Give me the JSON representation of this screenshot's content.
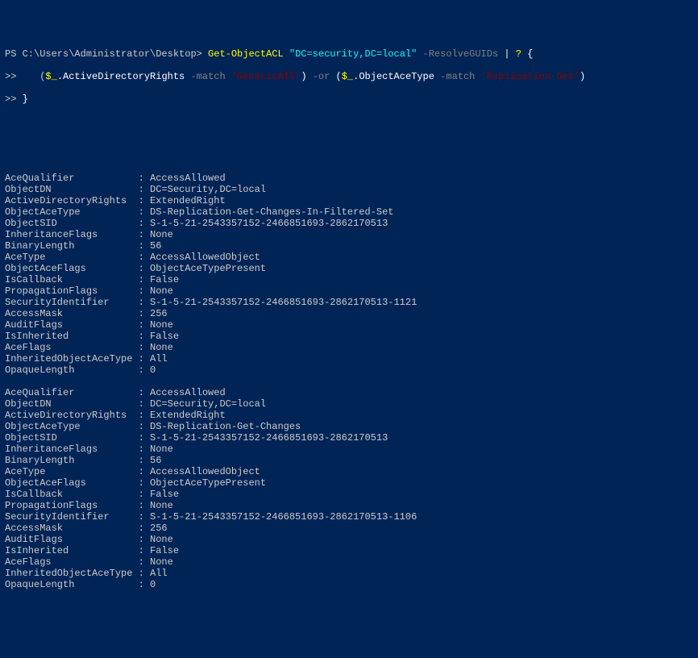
{
  "prompt": {
    "path": "PS C:\\Users\\Administrator\\Desktop> ",
    "cmd1": "Get-ObjectACL ",
    "arg1": "\"DC=security,DC=local\" ",
    "param1": "-ResolveGUIDs ",
    "pipe1": "| ",
    "cmd2": "? ",
    "brace1": "{",
    "cont1": ">>    (",
    "var1": "$_",
    "dot1": ".ActiveDirectoryRights ",
    "match1": "-match ",
    "str1": "'GenericAll'",
    "close1": ") ",
    "or1": "-or ",
    "open2": "(",
    "var2": "$_",
    "dot2": ".ObjectAceType ",
    "match2": "-match ",
    "str2": "'Replication-Get'",
    "close2": ")",
    "cont2": ">> ",
    "brace2": "}"
  },
  "records": [
    {
      "AceQualifier": "AccessAllowed",
      "ObjectDN": "DC=Security,DC=local",
      "ActiveDirectoryRights": "ExtendedRight",
      "ObjectAceType": "DS-Replication-Get-Changes-In-Filtered-Set",
      "ObjectSID": "S-1-5-21-2543357152-2466851693-2862170513",
      "InheritanceFlags": "None",
      "BinaryLength": "56",
      "AceType": "AccessAllowedObject",
      "ObjectAceFlags": "ObjectAceTypePresent",
      "IsCallback": "False",
      "PropagationFlags": "None",
      "SecurityIdentifier": "S-1-5-21-2543357152-2466851693-2862170513-1121",
      "AccessMask": "256",
      "AuditFlags": "None",
      "IsInherited": "False",
      "AceFlags": "None",
      "InheritedObjectAceType": "All",
      "OpaqueLength": "0"
    },
    {
      "AceQualifier": "AccessAllowed",
      "ObjectDN": "DC=Security,DC=local",
      "ActiveDirectoryRights": "ExtendedRight",
      "ObjectAceType": "DS-Replication-Get-Changes",
      "ObjectSID": "S-1-5-21-2543357152-2466851693-2862170513",
      "InheritanceFlags": "None",
      "BinaryLength": "56",
      "AceType": "AccessAllowedObject",
      "ObjectAceFlags": "ObjectAceTypePresent",
      "IsCallback": "False",
      "PropagationFlags": "None",
      "SecurityIdentifier": "S-1-5-21-2543357152-2466851693-2862170513-1106",
      "AccessMask": "256",
      "AuditFlags": "None",
      "IsInherited": "False",
      "AceFlags": "None",
      "InheritedObjectAceType": "All",
      "OpaqueLength": "0"
    }
  ]
}
